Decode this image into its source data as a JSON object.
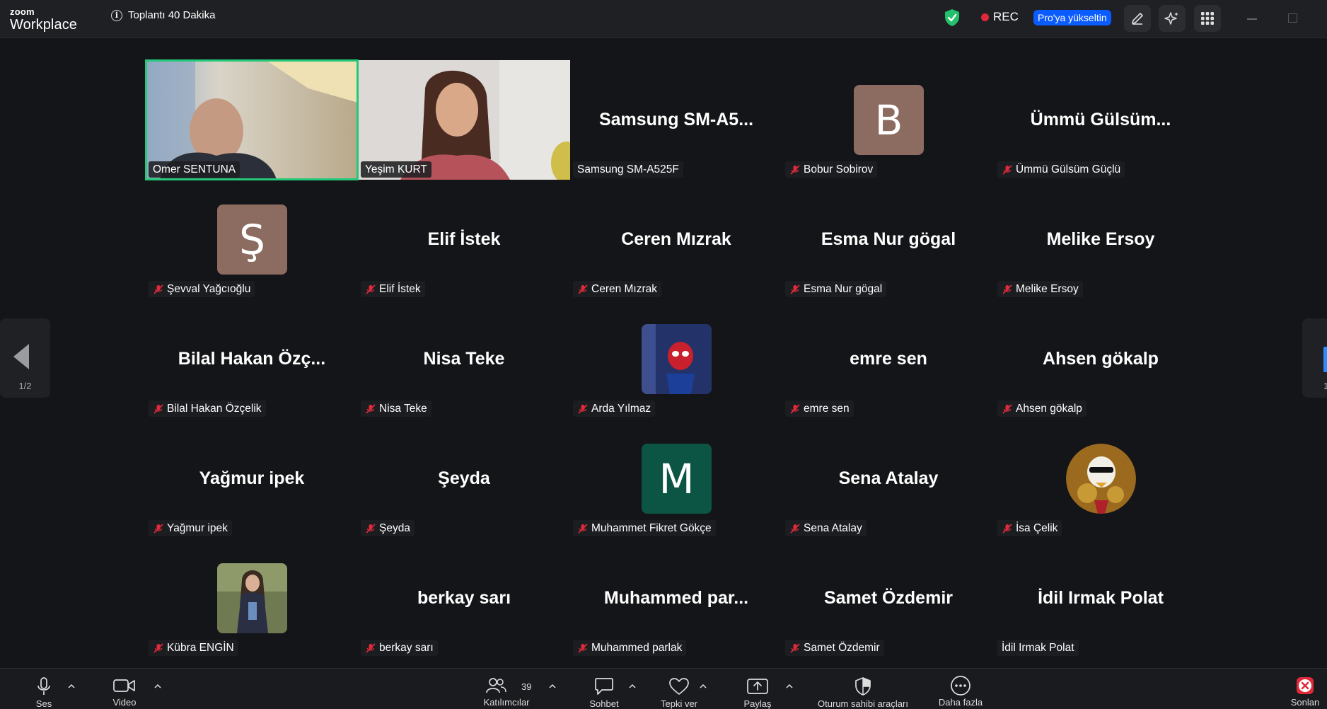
{
  "app": {
    "brand_small": "zoom",
    "brand_large": "Workplace",
    "meeting_title": "Toplantı 40 Dakika",
    "rec_label": "REC",
    "upgrade_label": "Pro'ya yükseltin"
  },
  "gallery": {
    "page_indicator": "1/2",
    "next_page_indicator": "1",
    "tiles": [
      {
        "name": "Omer SENTUNA",
        "type": "video"
      },
      {
        "name": "Yeşim KURT",
        "type": "video"
      },
      {
        "name": "Samsung SM-A525F",
        "big": "Samsung  SM-A5...",
        "muted": false
      },
      {
        "name": "Bobur Sobirov",
        "avatar_letter": "B",
        "avatar_color": "#8c6b61",
        "muted": true
      },
      {
        "name": "Ümmü Gülsüm Güçlü",
        "big": "Ümmü  Gülsüm...",
        "muted": true
      },
      {
        "name": "Şevval Yağcıoğlu",
        "avatar_letter": "Ş",
        "avatar_color": "#8c6b61",
        "muted": true
      },
      {
        "name": "Elif  İstek",
        "big": "Elif  İstek",
        "muted": true
      },
      {
        "name": "Ceren Mızrak",
        "big": "Ceren Mızrak",
        "muted": true
      },
      {
        "name": "Esma Nur gögal",
        "big": "Esma Nur gögal",
        "muted": true
      },
      {
        "name": "Melike Ersoy",
        "big": "Melike Ersoy",
        "muted": true
      },
      {
        "name": "Bilal Hakan Özçelik",
        "big": "Bilal  Hakan  Özç...",
        "muted": true
      },
      {
        "name": "Nisa Teke",
        "big": "Nisa Teke",
        "muted": true
      },
      {
        "name": "Arda Yılmaz",
        "avatar_image": "spiderman",
        "muted": true
      },
      {
        "name": "emre sen",
        "big": "emre sen",
        "muted": true
      },
      {
        "name": "Ahsen gökalp",
        "big": "Ahsen gökalp",
        "muted": true
      },
      {
        "name": "Yağmur ipek",
        "big": "Yağmur ipek",
        "muted": true
      },
      {
        "name": "Şeyda",
        "big": "Şeyda",
        "muted": true
      },
      {
        "name": "Muhammet Fikret Gökçe",
        "avatar_letter": "M",
        "avatar_color": "#0c5443",
        "muted": true
      },
      {
        "name": "Sena Atalay",
        "big": "Sena Atalay",
        "muted": true
      },
      {
        "name": "İsa Çelik",
        "avatar_image": "cartoon-duck",
        "muted": true
      },
      {
        "name": "Kübra ENGİN",
        "avatar_image": "photo-person",
        "muted": true
      },
      {
        "name": "berkay sarı",
        "big": "berkay sarı",
        "muted": true
      },
      {
        "name": "Muhammed parlak",
        "big": "Muhammed  par...",
        "muted": true
      },
      {
        "name": "Samet Özdemir",
        "big": "Samet Özdemir",
        "muted": true
      },
      {
        "name": "İdil Irmak Polat",
        "big": "İdil Irmak Polat",
        "muted": false
      }
    ]
  },
  "toolbar": {
    "audio_label": "Ses",
    "video_label": "Video",
    "participants_label": "Katılımcılar",
    "participants_count": "39",
    "chat_label": "Sohbet",
    "react_label": "Tepki ver",
    "share_label": "Paylaş",
    "host_tools_label": "Oturum sahibi araçları",
    "more_label": "Daha fazla",
    "end_label": "Sonlan"
  },
  "colors": {
    "active_speaker": "#24c879",
    "upgrade_bg": "#0b5cff",
    "rec_dot": "#e02a3b",
    "muted_red": "#e02a3b"
  }
}
